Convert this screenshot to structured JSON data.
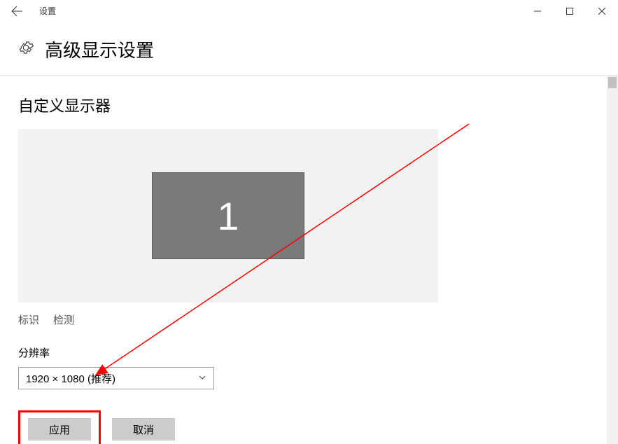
{
  "window": {
    "app_title": "设置"
  },
  "header": {
    "page_title": "高级显示设置"
  },
  "content": {
    "section_title": "自定义显示器",
    "monitor_number": "1",
    "links": {
      "identify": "标识",
      "detect": "检测"
    },
    "resolution": {
      "label": "分辨率",
      "selected": "1920 × 1080 (推荐)"
    },
    "buttons": {
      "apply": "应用",
      "cancel": "取消"
    }
  }
}
